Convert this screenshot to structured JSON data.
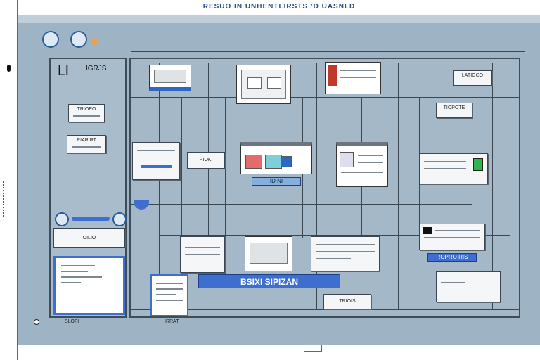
{
  "window": {
    "title": "RESUO IN UNHENTLIRSTS ’D UASNLD"
  },
  "sidebar": {
    "label": "Ll",
    "label2": "IGRJS"
  },
  "cards": {
    "left_top": "TRIOEO",
    "left_mid": "RIARIRT",
    "left_strip": "OILIO",
    "center_caption": "ID NI",
    "center_left_label": "TRIOKIT",
    "top_right_label": "LATIGCO",
    "right_label": "TIOPOTE",
    "right_strip": "ROPRO RIS",
    "bottom_banner": "BSIXI SIPIZAN",
    "bottom_card": "TRIOIS",
    "bottom_left_caption": "SLOFI",
    "bottom_caption2": "IRRAT"
  },
  "colors": {
    "workspace": "#9eb3c3",
    "accent": "#3f6fce",
    "border": "#3a4650"
  }
}
